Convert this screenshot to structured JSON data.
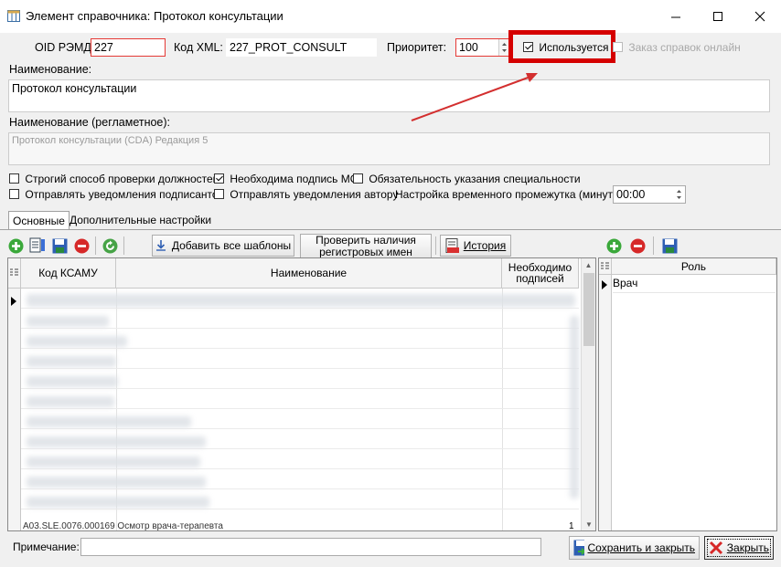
{
  "window": {
    "title": "Элемент справочника: Протокол консультации"
  },
  "form": {
    "oid_label": "OID РЭМД:",
    "oid_value": "227",
    "xml_label": "Код XML:",
    "xml_value": "227_PROT_CONSULT",
    "priority_label": "Приоритет:",
    "priority_value": "100",
    "used_label": "Используется",
    "used_checked": true,
    "online_order_label": "Заказ справок онлайн",
    "name_label": "Наименование:",
    "name_value": "Протокол консультации",
    "reg_name_label": "Наименование (регламетное):",
    "reg_name_value": "Протокол консультации (CDA) Редакция 5"
  },
  "options": {
    "strict_check": "Строгий способ проверки должностей",
    "need_sign_mo": "Необходима подпись МО",
    "need_specialty": "Обязательность указания специальности",
    "notify_signers": "Отправлять уведомления подписантов",
    "notify_author": "Отправлять уведомления автору",
    "time_setting_label": "Настройка временного промежутка (минуты):",
    "time_setting_value": "00:00"
  },
  "tabs": [
    "Основные",
    "Дополнительные настройки"
  ],
  "toolbar": {
    "add_all_templates": "Добавить все шаблоны",
    "check_reg_names_l1": "Проверить наличия",
    "check_reg_names_l2": "регистровых имен",
    "history": "История"
  },
  "grid": {
    "col_code": "Код КСАМУ",
    "col_name": "Наименование",
    "col_sign_l1": "Необходимо",
    "col_sign_l2": "подписей",
    "partial_row": "A03.SLE.0076.000169 Осмотр врача-терапевта",
    "partial_row_count": "1"
  },
  "roles": {
    "col_role": "Роль",
    "rows": [
      "Врач"
    ]
  },
  "footer": {
    "note_label": "Примечание:",
    "note_value": "",
    "save_close": "Сохранить и закрыть",
    "close": "Закрыть"
  },
  "colors": {
    "highlight_red": "#d50000",
    "arrow_red": "#d32f2f",
    "error_border": "#e53935"
  }
}
